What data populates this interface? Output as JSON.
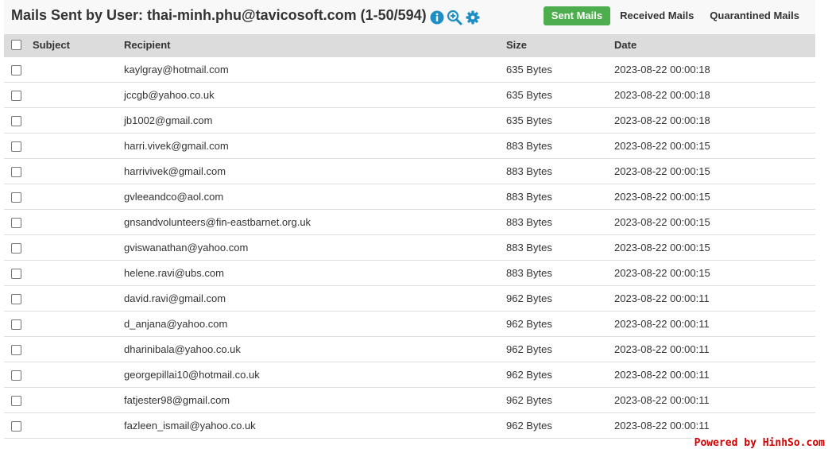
{
  "header": {
    "title": "Mails Sent by User: thai-minh.phu@tavicosoft.com (1-50/594)",
    "icons": [
      "info-icon",
      "zoom-in-icon",
      "gear-icon"
    ],
    "accent_color": "#1e8fc6",
    "tabs": [
      {
        "label": "Sent Mails",
        "active": true
      },
      {
        "label": "Received Mails",
        "active": false
      },
      {
        "label": "Quarantined Mails",
        "active": false
      }
    ],
    "active_tab_color": "#4cae4c"
  },
  "table": {
    "columns": [
      "Subject",
      "Recipient",
      "Size",
      "Date"
    ],
    "rows": [
      {
        "subject": "",
        "recipient": "kaylgray@hotmail.com",
        "size": "635 Bytes",
        "date": "2023-08-22 00:00:18"
      },
      {
        "subject": "",
        "recipient": "jccgb@yahoo.co.uk",
        "size": "635 Bytes",
        "date": "2023-08-22 00:00:18"
      },
      {
        "subject": "",
        "recipient": "jb1002@gmail.com",
        "size": "635 Bytes",
        "date": "2023-08-22 00:00:18"
      },
      {
        "subject": "",
        "recipient": "harri.vivek@gmail.com",
        "size": "883 Bytes",
        "date": "2023-08-22 00:00:15"
      },
      {
        "subject": "",
        "recipient": "harrivivek@gmail.com",
        "size": "883 Bytes",
        "date": "2023-08-22 00:00:15"
      },
      {
        "subject": "",
        "recipient": "gvleeandco@aol.com",
        "size": "883 Bytes",
        "date": "2023-08-22 00:00:15"
      },
      {
        "subject": "",
        "recipient": "gnsandvolunteers@fin-eastbarnet.org.uk",
        "size": "883 Bytes",
        "date": "2023-08-22 00:00:15"
      },
      {
        "subject": "",
        "recipient": "gviswanathan@yahoo.com",
        "size": "883 Bytes",
        "date": "2023-08-22 00:00:15"
      },
      {
        "subject": "",
        "recipient": "helene.ravi@ubs.com",
        "size": "883 Bytes",
        "date": "2023-08-22 00:00:15"
      },
      {
        "subject": "",
        "recipient": "david.ravi@gmail.com",
        "size": "962 Bytes",
        "date": "2023-08-22 00:00:11"
      },
      {
        "subject": "",
        "recipient": "d_anjana@yahoo.com",
        "size": "962 Bytes",
        "date": "2023-08-22 00:00:11"
      },
      {
        "subject": "",
        "recipient": "dharinibala@yahoo.co.uk",
        "size": "962 Bytes",
        "date": "2023-08-22 00:00:11"
      },
      {
        "subject": "",
        "recipient": "georgepillai10@hotmail.co.uk",
        "size": "962 Bytes",
        "date": "2023-08-22 00:00:11"
      },
      {
        "subject": "",
        "recipient": "fatjester98@gmail.com",
        "size": "962 Bytes",
        "date": "2023-08-22 00:00:11"
      },
      {
        "subject": "",
        "recipient": "fazleen_ismail@yahoo.co.uk",
        "size": "962 Bytes",
        "date": "2023-08-22 00:00:11"
      }
    ]
  },
  "footer": {
    "text": "Powered by HinhSo.com",
    "color": "#d10000"
  }
}
